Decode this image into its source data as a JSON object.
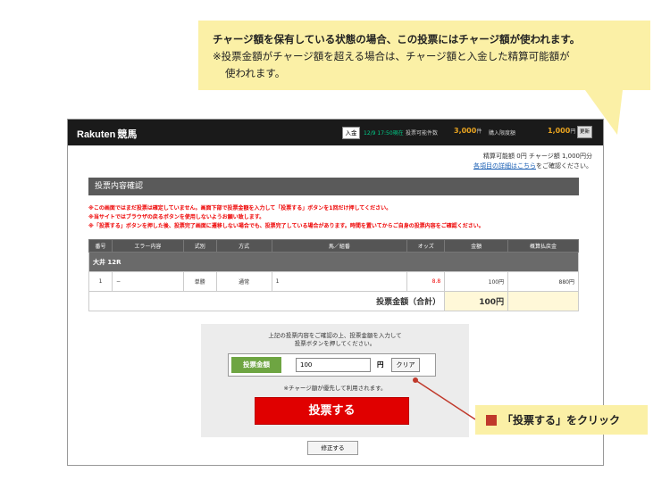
{
  "callout_top": {
    "line1": "チャージ額を保有している状態の場合、この投票にはチャージ額が使われます。",
    "line2": "※投票金額がチャージ額を超える場合は、チャージ額と入金した精算可能額が",
    "line3": "使われます。"
  },
  "header": {
    "logo": "Rakuten",
    "logo_sub": "競馬",
    "deposit_label": "入金",
    "time": "12/9 17:50現在",
    "votable_label": "投票可能件数",
    "count": "3,000",
    "count_unit": "件",
    "limit_label": "購入限度額",
    "amount": "1,000",
    "amount_unit": "円",
    "update_label": "更新"
  },
  "balance": {
    "settle_text": "精算可能額 0円 チャージ額 1,000円分",
    "details_link": "各項目の詳細はこちら",
    "details_suffix": "をご確認ください。"
  },
  "section_title": "投票内容確認",
  "warnings": [
    "※この画面ではまだ投票は確定していません。画面下部で投票金額を入力して「投票する」ボタンを1回だけ押してください。",
    "※当サイトではブラウザの戻るボタンを使用しないようお願い致します。",
    "※「投票する」ボタンを押した後、投票完了画面に遷移しない場合でも、投票完了している場合があります。時間を置いてからご自身の投票内容をご確認ください。"
  ],
  "table": {
    "headers": [
      "番号",
      "エラー内容",
      "式別",
      "方式",
      "馬／組番",
      "オッズ",
      "金額",
      "概算払戻金"
    ],
    "race": "大井 12R",
    "row": {
      "num": "1",
      "error": "−",
      "type": "単勝",
      "method": "通常",
      "horse": "1",
      "odds": "8.8",
      "amount": "100円",
      "payout": "880円"
    },
    "total_label": "投票金額（合計）",
    "total_amount": "100円"
  },
  "vote": {
    "msg1": "上記の投票内容をご確認の上、投票金額を入力して",
    "msg2": "投票ボタンを押してください。",
    "amount_label": "投票金額",
    "amount_value": "100",
    "yen": "円",
    "clear_label": "クリア",
    "charge_note": "※チャージ額が優先して利用されます。",
    "vote_button": "投票する",
    "fix_button": "修正する"
  },
  "callout_bottom": {
    "text": "「投票する」をクリック"
  },
  "colors": {
    "callout_bg": "#fbf0a6",
    "vote_red": "#e00000",
    "label_green": "#6ea542",
    "header_dark": "#1a1a1a",
    "pointer_red": "#c0392b"
  }
}
